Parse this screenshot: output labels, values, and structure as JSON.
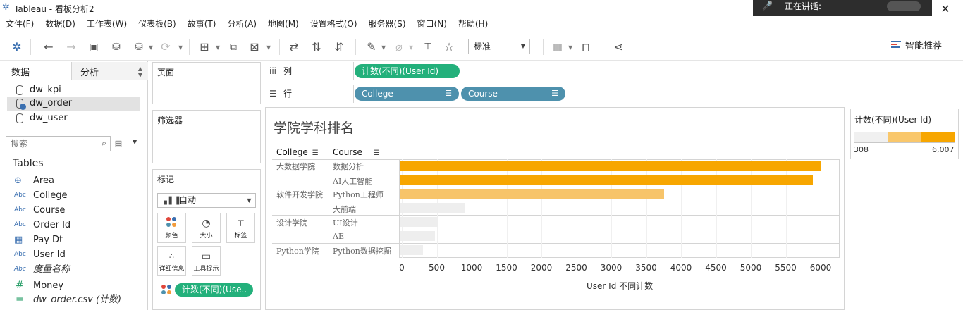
{
  "window": {
    "title": "Tableau - 看板分析2",
    "speaking_label": "正在讲话:"
  },
  "menu": [
    "文件(F)",
    "数据(D)",
    "工作表(W)",
    "仪表板(B)",
    "故事(T)",
    "分析(A)",
    "地图(M)",
    "设置格式(O)",
    "服务器(S)",
    "窗口(N)",
    "帮助(H)"
  ],
  "toolbar": {
    "fit_select": "标准",
    "smart_label": "智能推荐"
  },
  "left_panel": {
    "tabs": [
      "数据",
      "分析"
    ],
    "datasources": [
      "dw_kpi",
      "dw_order",
      "dw_user"
    ],
    "selected_datasource": "dw_order",
    "search_placeholder": "搜索",
    "tables_title": "Tables",
    "fields": [
      {
        "type": "Abc",
        "name": "Area",
        "icon": "globe-icon"
      },
      {
        "type": "Abc",
        "name": "College"
      },
      {
        "type": "Abc",
        "name": "Course"
      },
      {
        "type": "Abc",
        "name": "Order Id"
      },
      {
        "type": "date",
        "name": "Pay Dt",
        "icon": "calendar-icon"
      },
      {
        "type": "Abc",
        "name": "User Id"
      },
      {
        "type": "Abc",
        "name": "度量名称",
        "italic": true
      }
    ],
    "measures": [
      {
        "type": "#",
        "name": "Money"
      },
      {
        "type": "=",
        "name": "dw_order.csv (计数)",
        "italic": true
      }
    ],
    "field_type_texts": {
      "abc": "Abc",
      "num": "#"
    }
  },
  "cards": {
    "pages": "页面",
    "filters": "筛选器",
    "marks": "标记",
    "marks_type": "自动",
    "mark_buttons": [
      "颜色",
      "大小",
      "标签",
      "详细信息",
      "工具提示"
    ],
    "mark_pill": "计数(不同)(Use.."
  },
  "shelves": {
    "columns_label": "列",
    "rows_label": "行",
    "columns_pills": [
      "计数(不同)(User Id)"
    ],
    "rows_pills": [
      "College",
      "Course"
    ]
  },
  "viz": {
    "title": "学院学科排名",
    "col_headers": [
      "College",
      "Course"
    ],
    "colleges": [
      "大数据学院",
      "软件开发学院",
      "设计学院",
      "Python学院"
    ],
    "courses": [
      "数据分析",
      "AI人工智能",
      "Python工程师",
      "大前端",
      "UI设计",
      "AE",
      "Python数据挖掘"
    ],
    "xlabel": "User Id 不同计数"
  },
  "legend": {
    "title": "计数(不同)(User Id)",
    "min": "308",
    "max": "6,007",
    "colors": [
      "#f0f0f0",
      "#f9c76b",
      "#f7a600"
    ]
  },
  "chart_data": {
    "type": "bar",
    "orientation": "horizontal",
    "title": "学院学科排名",
    "xlabel": "User Id 不同计数",
    "xlim": [
      0,
      6300
    ],
    "ticks": [
      0,
      500,
      1000,
      1500,
      2000,
      2500,
      3000,
      3500,
      4000,
      4500,
      5000,
      5500,
      6000
    ],
    "rows": [
      {
        "college": "大数据学院",
        "course": "数据分析",
        "value": 6007,
        "color": "#f7a600"
      },
      {
        "college": "大数据学院",
        "course": "AI人工智能",
        "value": 5890,
        "color": "#f7a600"
      },
      {
        "college": "软件开发学院",
        "course": "Python工程师",
        "value": 3760,
        "color": "#f7c46a"
      },
      {
        "college": "软件开发学院",
        "course": "大前端",
        "value": 910,
        "color": "#eeeeee"
      },
      {
        "college": "设计学院",
        "course": "UI设计",
        "value": 520,
        "color": "#eeeeee"
      },
      {
        "college": "设计学院",
        "course": "AE",
        "value": 470,
        "color": "#eeeeee"
      },
      {
        "college": "Python学院",
        "course": "Python数据挖掘",
        "value": 308,
        "color": "#eeeeee"
      }
    ]
  }
}
